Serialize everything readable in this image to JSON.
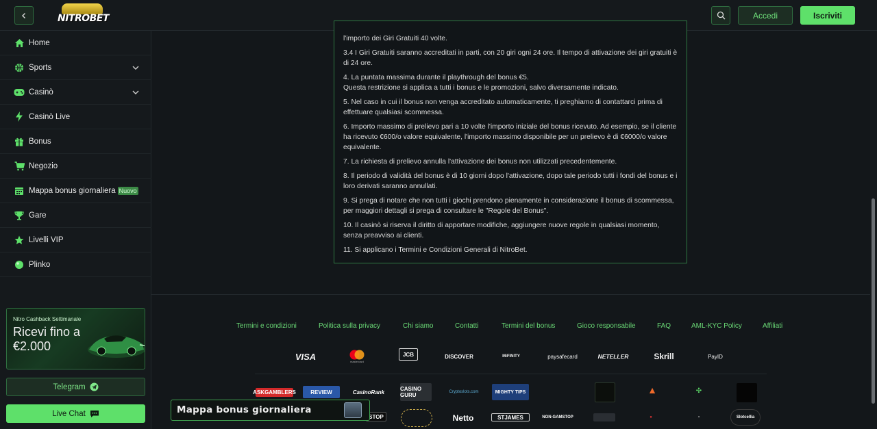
{
  "header": {
    "logo_text": "NITROBET",
    "login_label": "Accedi",
    "register_label": "Iscriviti"
  },
  "sidebar": {
    "items": [
      {
        "label": "Home",
        "icon": "home-icon"
      },
      {
        "label": "Sports",
        "icon": "sports-ball-icon",
        "has_chevron": true
      },
      {
        "label": "Casinò",
        "icon": "gamepad-icon",
        "has_chevron": true
      },
      {
        "label": "Casinò Live",
        "icon": "lightning-icon"
      },
      {
        "label": "Bonus",
        "icon": "gift-icon"
      },
      {
        "label": "Negozio",
        "icon": "cart-icon"
      },
      {
        "label": "Mappa bonus giornaliera",
        "icon": "calendar-icon",
        "badge": "Nuovo"
      },
      {
        "label": "Gare",
        "icon": "trophy-icon"
      },
      {
        "label": "Livelli VIP",
        "icon": "star-icon"
      },
      {
        "label": "Plinko",
        "icon": "plinko-icon"
      }
    ],
    "promo": {
      "subtitle": "Nitro Cashback Settimanale",
      "headline": "Ricevi fino a €2.000"
    },
    "telegram_label": "Telegram",
    "livechat_label": "Live Chat"
  },
  "terms": [
    "l'importo dei Giri Gratuiti 40 volte.",
    "3.4 I Giri Gratuiti saranno accreditati in parti, con 20 giri ogni 24 ore. Il tempo di attivazione dei giri gratuiti è di 24 ore.",
    "4. La puntata massima durante il playthrough del bonus €5.",
    "Questa restrizione si applica a tutti i bonus e le promozioni, salvo diversamente indicato.",
    "5. Nel caso in cui il bonus non venga accreditato automaticamente, ti preghiamo di contattarci prima di effettuare qualsiasi scommessa.",
    "6. Importo massimo di prelievo pari a 10 volte l'importo iniziale del bonus ricevuto. Ad esempio, se il cliente ha ricevuto €600/o valore equivalente, l'importo massimo disponibile per un prelievo è di €6000/o valore equivalente.",
    "7. La richiesta di prelievo annulla l'attivazione dei bonus non utilizzati precedentemente.",
    "8. Il periodo di validità del bonus è di 10 giorni dopo l'attivazione, dopo tale periodo tutti i fondi del bonus e i loro derivati saranno annullati.",
    "9. Si prega di notare che non tutti i giochi prendono pienamente in considerazione il bonus di scommessa, per maggiori dettagli si prega di consultare le \"Regole del Bonus\".",
    "10. Il casinò si riserva il diritto di apportare modifiche, aggiungere nuove regole in qualsiasi momento, senza preavviso ai clienti.",
    "11. Si applicano i Termini e Condizioni Generali di NitroBet."
  ],
  "footer": {
    "links": [
      "Termini e condizioni",
      "Politica sulla privacy",
      "Chi siamo",
      "Contatti",
      "Termini del bonus",
      "Gioco responsabile",
      "FAQ",
      "AML-KYC Policy",
      "Affiliati"
    ],
    "payments": [
      "VISA",
      "mastercard",
      "JCB",
      "DISCOVER",
      "MiFINITY",
      "paysafecard",
      "NETELLER",
      "Skrill",
      "PayID"
    ],
    "partners_row1": [
      "ASKGAMBLERS",
      "REVIEW",
      "CasinoRank",
      "CASINO GURU",
      "Cryptoslots.com",
      "MIGHTY TIPS",
      "",
      "",
      "",
      ""
    ],
    "partners_row2": [
      "STOP",
      "",
      "Netto",
      "STJAMES",
      "NON-GAMSTOP",
      "",
      "",
      "",
      "Slotcellia"
    ]
  },
  "daily_banner": {
    "label": "Mappa bonus giornaliera"
  },
  "colors": {
    "accent": "#5ee06a",
    "background": "#13171a",
    "panel": "#15191c",
    "border_green": "#2f7a43"
  }
}
